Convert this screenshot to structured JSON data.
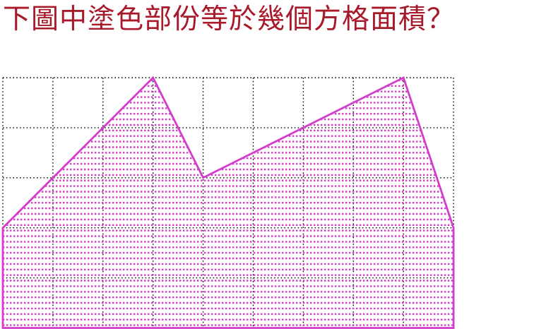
{
  "question": {
    "text": "下圖中塗色部份等於幾個方格面積？"
  },
  "figure": {
    "grid": {
      "columns": 9,
      "rows": 5,
      "line_style": "dotted",
      "line_color": "#000000"
    },
    "shaded_region": {
      "description_vertices_in_grid_units": [
        [
          0,
          2
        ],
        [
          3,
          5
        ],
        [
          4,
          3
        ],
        [
          8,
          5
        ],
        [
          9,
          2
        ],
        [
          9,
          0
        ],
        [
          0,
          0
        ]
      ],
      "outline_color": "#d43ccc",
      "fill_style": "horizontal dotted hatching",
      "hatch_color": "#d43ccc"
    },
    "colors": {
      "title": "#a8192a",
      "outline": "#d43ccc",
      "grid": "#000000",
      "background": "#ffffff"
    }
  }
}
